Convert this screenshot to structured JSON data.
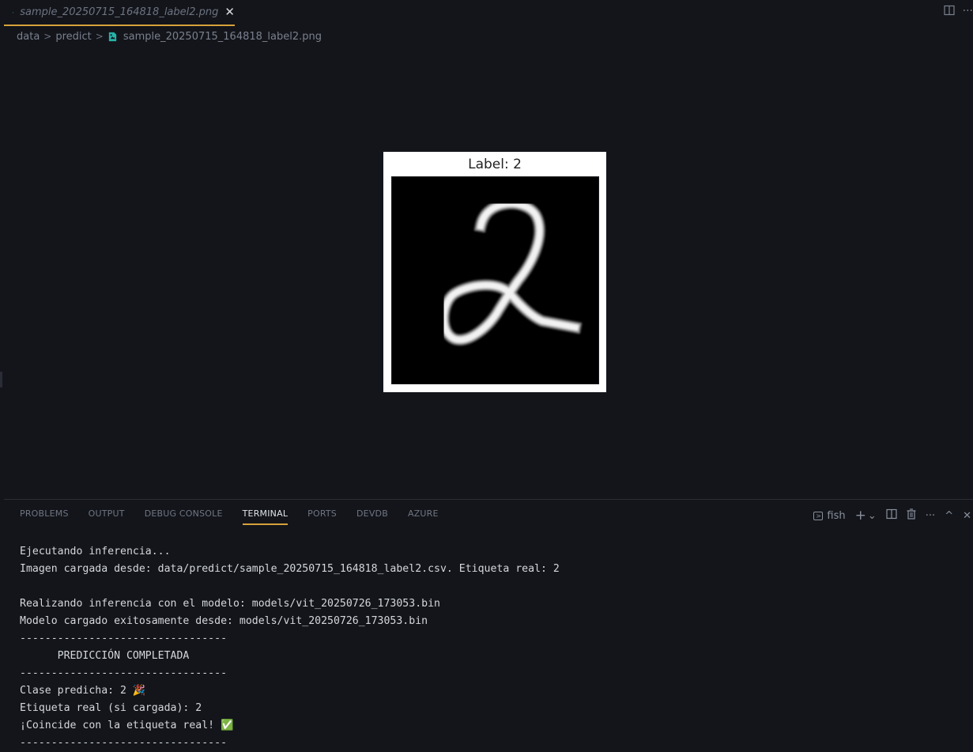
{
  "tab": {
    "filename": "sample_20250715_164818_label2.png",
    "close_glyph": "✕",
    "file_icon": "image-file-icon"
  },
  "editor_actions": {
    "split_icon": "split-editor-icon",
    "more_icon": "more-actions-icon",
    "more_glyph": "···"
  },
  "breadcrumb": {
    "items": [
      "data",
      "predict",
      "sample_20250715_164818_label2.png"
    ],
    "separator": ">"
  },
  "image": {
    "caption": "Label: 2"
  },
  "panel": {
    "tabs": [
      "PROBLEMS",
      "OUTPUT",
      "DEBUG CONSOLE",
      "TERMINAL",
      "PORTS",
      "DEVDB",
      "AZURE"
    ],
    "active_tab": "TERMINAL",
    "shell_name": "fish",
    "add_glyph": "+",
    "dropdown_glyph": "⌄",
    "more_glyph": "···",
    "maximize_glyph": "^",
    "close_glyph": "✕"
  },
  "terminal": {
    "lines": [
      "Ejecutando inferencia...",
      "Imagen cargada desde: data/predict/sample_20250715_164818_label2.csv. Etiqueta real: 2",
      "",
      "Realizando inferencia con el modelo: models/vit_20250726_173053.bin",
      "Modelo cargado exitosamente desde: models/vit_20250726_173053.bin",
      "---------------------------------",
      "      PREDICCIÓN COMPLETADA",
      "---------------------------------",
      "Clase predicha: 2 🎉",
      "Etiqueta real (si cargada): 2",
      "¡Coincide con la etiqueta real! ✅",
      "---------------------------------"
    ]
  },
  "colors": {
    "background": "#13151b",
    "accent": "#d7a23a",
    "file_icon": "#26b3a8"
  }
}
